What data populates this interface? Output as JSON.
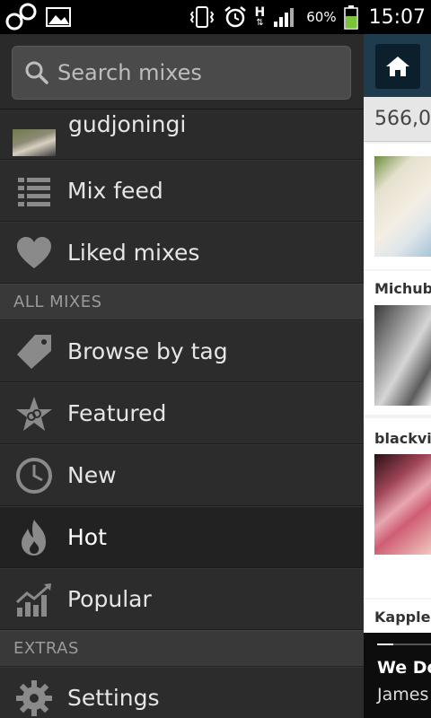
{
  "status_bar": {
    "time": "15:07",
    "battery_percent": "60%",
    "network_type": "H",
    "icons": [
      "8tracks-logo-icon",
      "image-notification-icon",
      "vibrate-icon",
      "alarm-icon",
      "network-h-icon",
      "signal-icon",
      "battery-icon"
    ]
  },
  "drawer": {
    "search": {
      "placeholder": "Search mixes",
      "icon": "search-icon"
    },
    "user": {
      "name": "gudjoningi"
    },
    "items_top": [
      {
        "label": "Mix feed",
        "icon": "list-icon"
      },
      {
        "label": "Liked mixes",
        "icon": "heart-icon"
      }
    ],
    "section_all": "ALL MIXES",
    "items_all": [
      {
        "label": "Browse by tag",
        "icon": "tag-icon"
      },
      {
        "label": "Featured",
        "icon": "star-icon"
      },
      {
        "label": "New",
        "icon": "clock-icon"
      },
      {
        "label": "Hot",
        "icon": "flame-icon",
        "active": true
      },
      {
        "label": "Popular",
        "icon": "chart-icon"
      }
    ],
    "section_extras": "EXTRAS",
    "items_extras": [
      {
        "label": "Settings",
        "icon": "gear-icon"
      }
    ]
  },
  "content": {
    "count": "566,0",
    "cards": [
      {
        "user": ""
      },
      {
        "user": "Michube"
      },
      {
        "user": "blackvir"
      },
      {
        "user": "Kapples"
      }
    ]
  },
  "player": {
    "title": "We Do",
    "artist": "James",
    "progress": 0.3
  },
  "colors": {
    "drawer_bg": "#2b2b2b",
    "section_bg": "#393939",
    "topbar": "#1f3b4e"
  }
}
